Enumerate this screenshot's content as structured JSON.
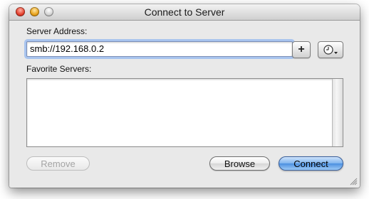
{
  "window": {
    "title": "Connect to Server"
  },
  "server_address": {
    "label": "Server Address:",
    "value": "smb://192.168.0.2"
  },
  "toolbar": {
    "add_icon": "plus-icon",
    "add_glyph": "+",
    "recent_icon": "clock-icon"
  },
  "favorites": {
    "label": "Favorite Servers:",
    "items": []
  },
  "buttons": {
    "remove": "Remove",
    "browse": "Browse",
    "connect": "Connect"
  },
  "colors": {
    "default_button": "#4b8fe0",
    "focus_ring": "#a8c4ee"
  }
}
